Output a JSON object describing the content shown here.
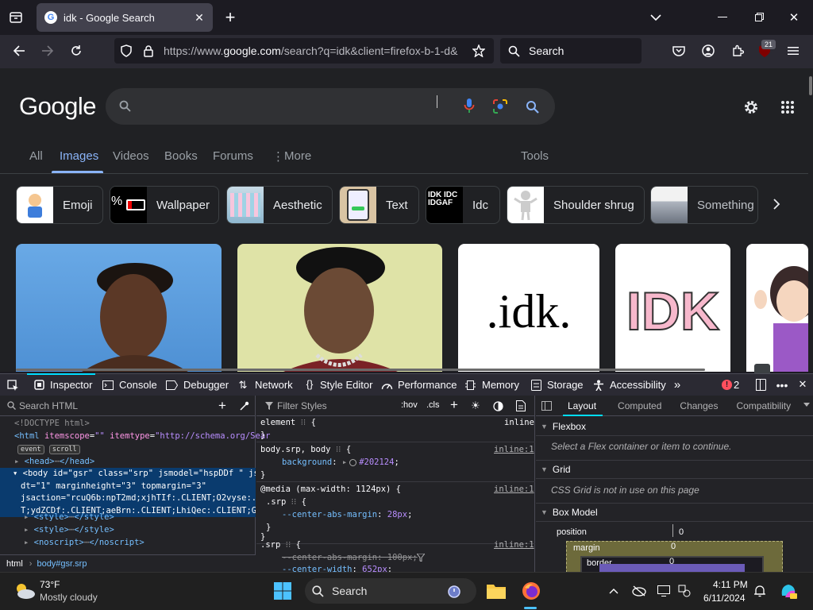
{
  "browser": {
    "tab_title": "idk - Google Search",
    "url_prefix": "https://www.",
    "url_domain": "google.com",
    "url_rest": "/search?q=idk&client=firefox-b-1-d&",
    "search_placeholder": "Search",
    "extension_badge": "21"
  },
  "google": {
    "logo": "Google",
    "tabs": [
      "All",
      "Images",
      "Videos",
      "Books",
      "Forums",
      "More",
      "Tools"
    ],
    "chips": [
      "Emoji",
      "Wallpaper",
      "Aesthetic",
      "Text",
      "Idc",
      "Shoulder shrug",
      "Something"
    ],
    "thumb_text_percent": "%",
    "thumb_text_idc": "IDK IDC IDGAF",
    "img_text_idk": ".idk.",
    "img_text_IDK": "IDK"
  },
  "devtools": {
    "tabs": [
      "Inspector",
      "Console",
      "Debugger",
      "Network",
      "Style Editor",
      "Performance",
      "Memory",
      "Storage",
      "Accessibility"
    ],
    "error_count": "2",
    "search_html": "Search HTML",
    "filter_styles": "Filter Styles",
    "hov": ":hov",
    "cls": ".cls",
    "html_lines": {
      "doctype": "<!DOCTYPE html>",
      "html_open": "<html",
      "html_attr1": "itemscope",
      "html_attr1_val": "\"\"",
      "html_attr2": "itemtype",
      "html_attr2_val": "\"http://schema.org/Sear",
      "badge_event": "event",
      "badge_scroll": "scroll",
      "head": "<head>",
      "head_close": "</head>",
      "body1": "<body id=\"gsr\" class=\"srp\" jsmodel=\"hspDDf \" jsco",
      "body2": "dt=\"1\" marginheight=\"3\" topmargin=\"3\"",
      "body3": "jsaction=\"rcuQ6b:npT2md;xjhTIf:.CLIENT;O2vyse:.CL",
      "body4": "T;ydZCDf:.CLIENT;aeBrn:.CLIENT;LhiQec:.CLIENT;Gvn",
      "style1": "<style>",
      "style1_close": "</style>",
      "style2": "<style>",
      "style2_close": "</style>",
      "noscript": "<noscript>",
      "noscript_close": "</noscript>"
    },
    "breadcrumb": [
      "html",
      "body#gsr.srp"
    ],
    "rules": {
      "r1_sel": "element",
      "r1_src": "inline",
      "r2_sel": "body.srp, body",
      "r2_src": "inline:1",
      "r2_prop": "background",
      "r2_val": "#202124",
      "r3_media": "@media (max-width: 1124px) {",
      "r3_src": "inline:1",
      "r3_sel": ".srp",
      "r3_prop": "--center-abs-margin",
      "r3_val": "28px",
      "r4_sel": ".srp",
      "r4_src": "inline:1",
      "r4_prop1": "--center-abs-margin: 100px;",
      "r4_prop2": "--center-width",
      "r4_val2": "652px"
    },
    "layout_tabs": [
      "Layout",
      "Computed",
      "Changes",
      "Compatibility"
    ],
    "flexbox_title": "Flexbox",
    "flexbox_msg": "Select a Flex container or item to continue.",
    "grid_title": "Grid",
    "grid_msg": "CSS Grid is not in use on this page",
    "boxmodel_title": "Box Model",
    "position_label": "position",
    "position_val": "0",
    "margin_label": "margin",
    "margin_val": "0",
    "border_label": "border",
    "border_val": "0"
  },
  "taskbar": {
    "temp": "73°F",
    "weather": "Mostly cloudy",
    "search": "Search",
    "time": "4:11 PM",
    "date": "6/11/2024"
  }
}
